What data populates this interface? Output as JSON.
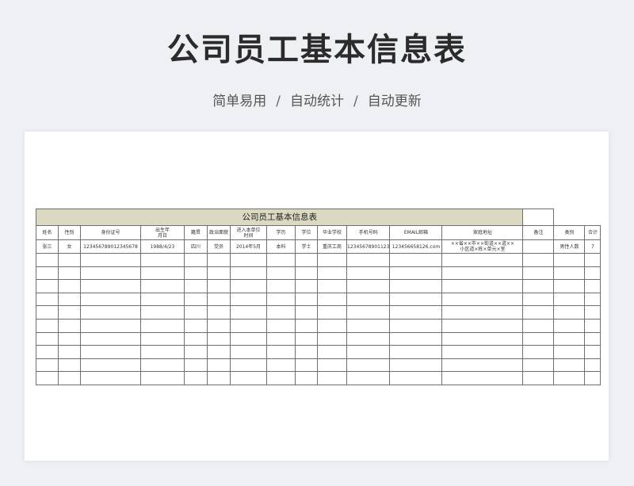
{
  "page": {
    "title": "公司员工基本信息表",
    "subtitle_parts": [
      "简单易用",
      "自动统计",
      "自动更新"
    ],
    "separator": "/"
  },
  "sheet": {
    "title": "公司员工基本信息表",
    "header_color": "#dcd9c2",
    "columns": [
      "姓名",
      "性别",
      "身份证号",
      "出生年\n月日",
      "籍贯",
      "政治面貌",
      "进入本单位\n时间",
      "学历",
      "学位",
      "毕业学校",
      "手机号码",
      "EMAIL邮箱",
      "家庭地址",
      "备注",
      "类别",
      "合计"
    ],
    "rows": [
      [
        "张三",
        "女",
        "123456789012345678",
        "1988/4/23",
        "四川",
        "党员",
        "2014年5月",
        "本科",
        "学士",
        "重庆工商",
        "12345678901123",
        "123456658126.com",
        "××省××市××街道××道××\n小区道×栋×单元×室",
        "",
        "男性人数",
        "7"
      ]
    ],
    "empty_rows": 10
  }
}
